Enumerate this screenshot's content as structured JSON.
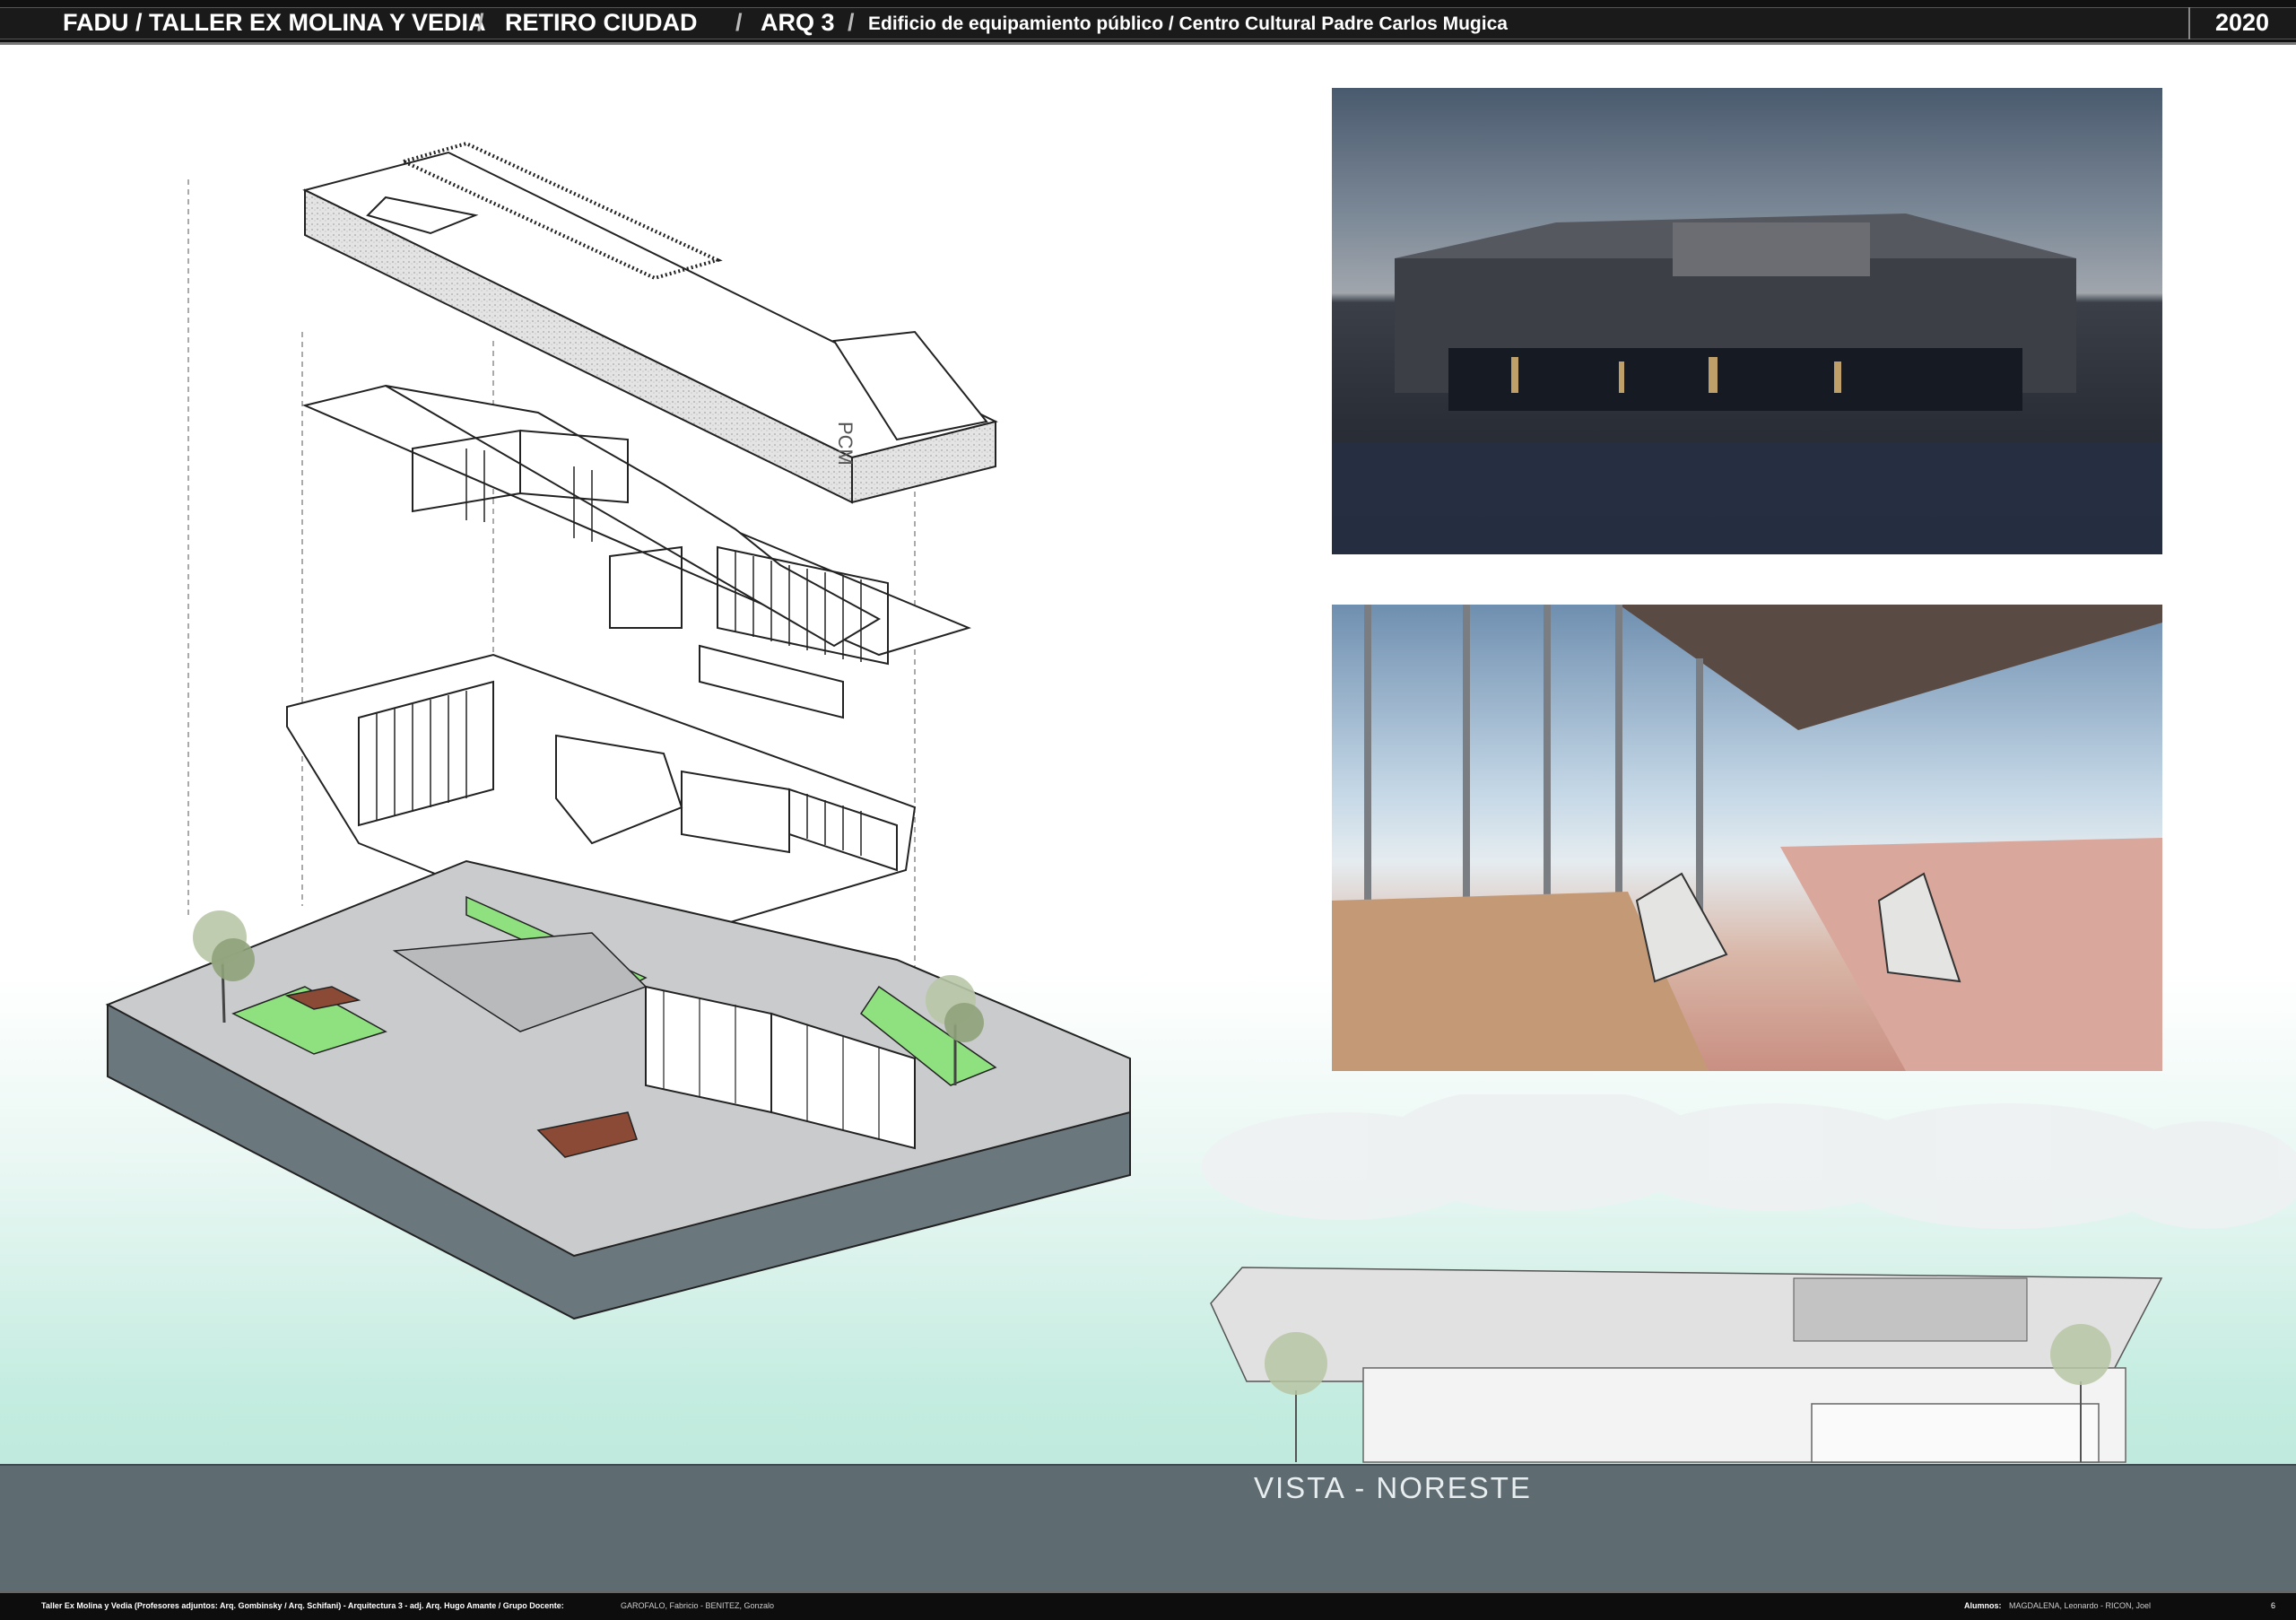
{
  "header": {
    "school": "FADU / TALLER EX MOLINA Y VEDIA",
    "separator": "/",
    "site": "RETIRO CIUDAD",
    "course": "ARQ 3",
    "description": "Edificio de equipamiento público / Centro Cultural Padre Carlos Mugica",
    "year": "2020"
  },
  "axonometric": {
    "facade_letters": "PCM"
  },
  "elevation": {
    "caption": "VISTA - NORESTE"
  },
  "footer": {
    "credits": "Taller Ex Molina y Vedia (Profesores adjuntos:  Arq. Gombinsky / Arq. Schifani) - Arquitectura 3 - adj. Arq. Hugo Amante / Grupo Docente:",
    "docentes": "GAROFALO, Fabricio - BENITEZ, Gonzalo",
    "students_label": "Alumnos:",
    "students": "MAGDALENA, Leonardo - RICON, Joel",
    "page": "6"
  },
  "colors": {
    "header_bg": "#111111",
    "ground": "#5e6b70",
    "lawn": "#8fe07e",
    "deck": "#8a4a35",
    "concrete": "#c9cbcc"
  }
}
